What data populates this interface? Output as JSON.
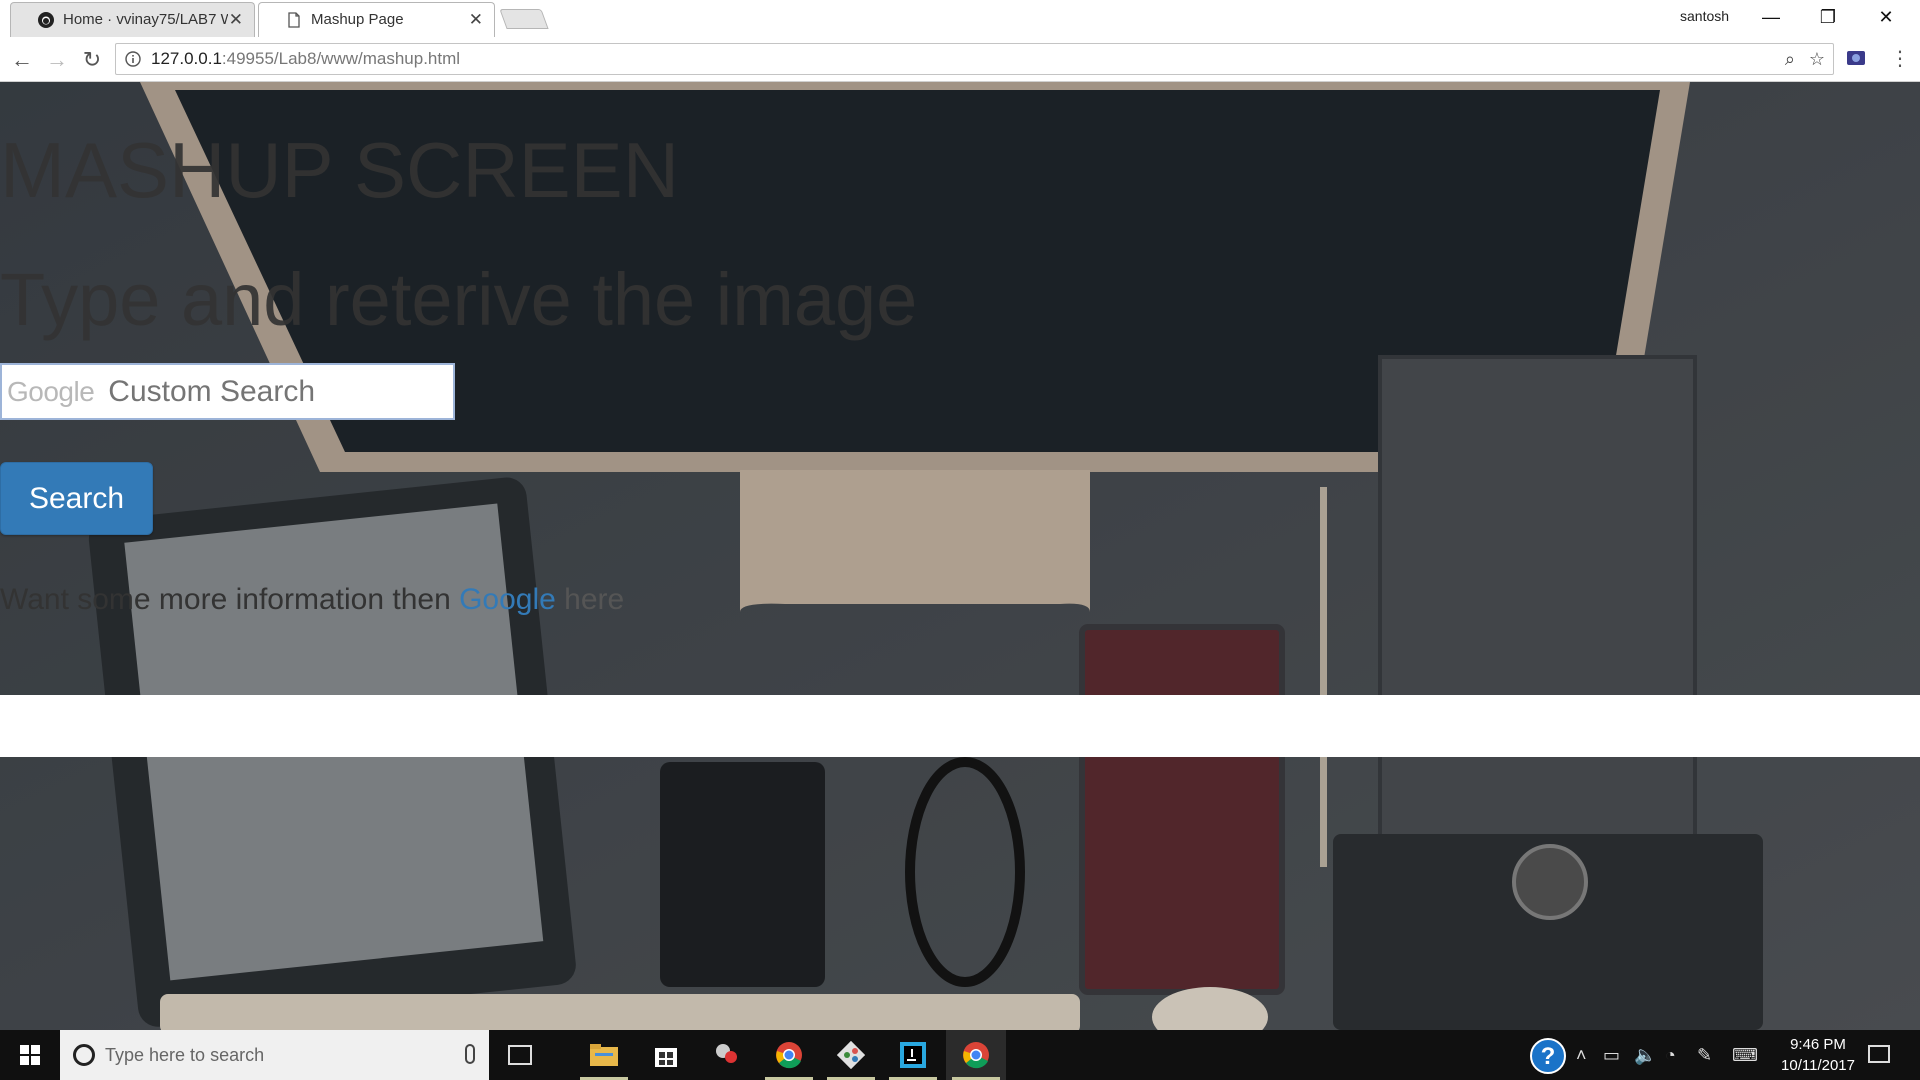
{
  "browser": {
    "tabs": [
      {
        "title": "Home · vvinay75/LAB7 W",
        "icon": "github-icon",
        "active": false
      },
      {
        "title": "Mashup Page",
        "icon": "page-icon",
        "active": true
      }
    ],
    "profile_name": "santosh",
    "url_host": "127.0.0.1",
    "url_rest": ":49955/Lab8/www/mashup.html"
  },
  "page": {
    "heading1": "MASHUP SCREEN",
    "heading2": "Type and reterive the image",
    "search": {
      "watermark": "Google",
      "placeholder": "Custom Search",
      "value": ""
    },
    "search_button": "Search",
    "info": {
      "prefix": "Want some more information then ",
      "link": "Google",
      "suffix": " here"
    }
  },
  "taskbar": {
    "search_placeholder": "Type here to search",
    "time": "9:46 PM",
    "date": "10/11/2017"
  },
  "colors": {
    "link": "#337ab7",
    "button": "#337ab7",
    "taskbar": "#101010"
  }
}
